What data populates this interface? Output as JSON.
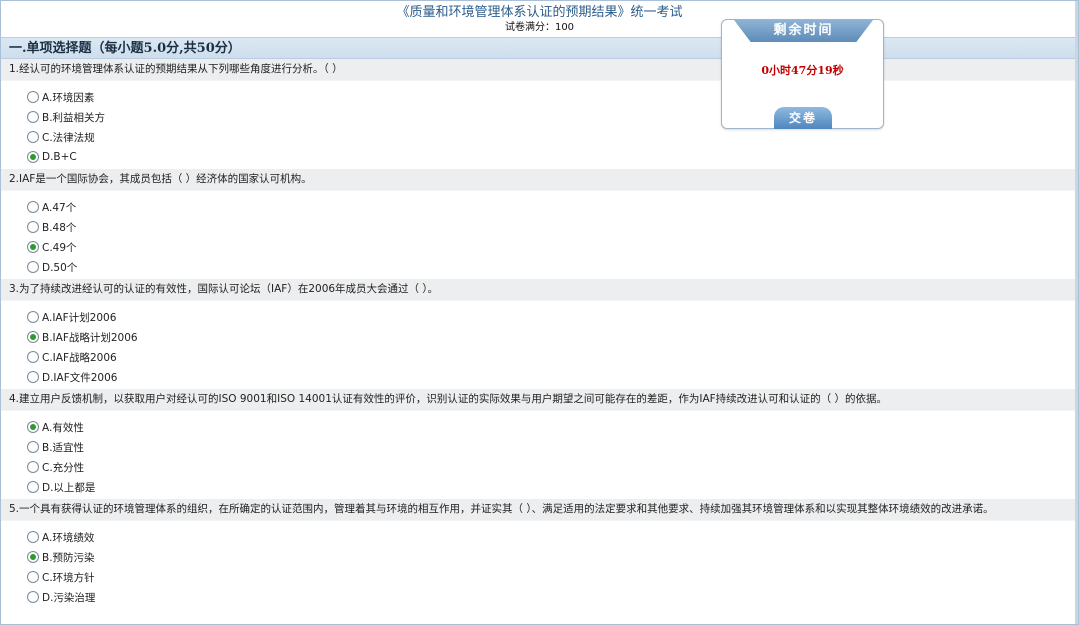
{
  "exam": {
    "title": "《质量和环境管理体系认证的预期结果》统一考试",
    "score": "试卷满分：100"
  },
  "section": {
    "title": "一.单项选择题（每小题5.0分,共50分）"
  },
  "questions": [
    {
      "text": "1.经认可的环境管理体系认证的预期结果从下列哪些角度进行分析。（ ）",
      "options": [
        {
          "label": "A.环境因素",
          "checked": false
        },
        {
          "label": "B.利益相关方",
          "checked": false
        },
        {
          "label": "C.法律法规",
          "checked": false
        },
        {
          "label": "D.B+C",
          "checked": true
        }
      ]
    },
    {
      "text": "2.IAF是一个国际协会，其成员包括（ ）经济体的国家认可机构。",
      "options": [
        {
          "label": "A.47个",
          "checked": false
        },
        {
          "label": "B.48个",
          "checked": false
        },
        {
          "label": "C.49个",
          "checked": true
        },
        {
          "label": "D.50个",
          "checked": false
        }
      ]
    },
    {
      "text": "3.为了持续改进经认可的认证的有效性，国际认可论坛（IAF）在2006年成员大会通过（ ）。",
      "options": [
        {
          "label": "A.IAF计划2006",
          "checked": false
        },
        {
          "label": "B.IAF战略计划2006",
          "checked": true
        },
        {
          "label": "C.IAF战略2006",
          "checked": false
        },
        {
          "label": "D.IAF文件2006",
          "checked": false
        }
      ]
    },
    {
      "text": "4.建立用户反馈机制，以获取用户对经认可的ISO 9001和ISO 14001认证有效性的评价，识别认证的实际效果与用户期望之间可能存在的差距，作为IAF持续改进认可和认证的（ ）的依据。",
      "options": [
        {
          "label": "A.有效性",
          "checked": true
        },
        {
          "label": "B.适宜性",
          "checked": false
        },
        {
          "label": "C.充分性",
          "checked": false
        },
        {
          "label": "D.以上都是",
          "checked": false
        }
      ]
    },
    {
      "text": "5.一个具有获得认证的环境管理体系的组织，在所确定的认证范围内，管理着其与环境的相互作用，并证实其（ ）、满足适用的法定要求和其他要求、持续加强其环境管理体系和以实现其整体环境绩效的改进承诺。",
      "options": [
        {
          "label": "A.环境绩效",
          "checked": false
        },
        {
          "label": "B.预防污染",
          "checked": true
        },
        {
          "label": "C.环境方针",
          "checked": false
        },
        {
          "label": "D.污染治理",
          "checked": false
        }
      ]
    }
  ],
  "timer": {
    "tab_label": "剩余时间",
    "remaining": "0小时47分19秒",
    "submit_label": "交卷"
  },
  "colors": {
    "accent": "#2a5c8c",
    "timer_text": "#c00000",
    "radio_checked": "#2f9a2f"
  }
}
